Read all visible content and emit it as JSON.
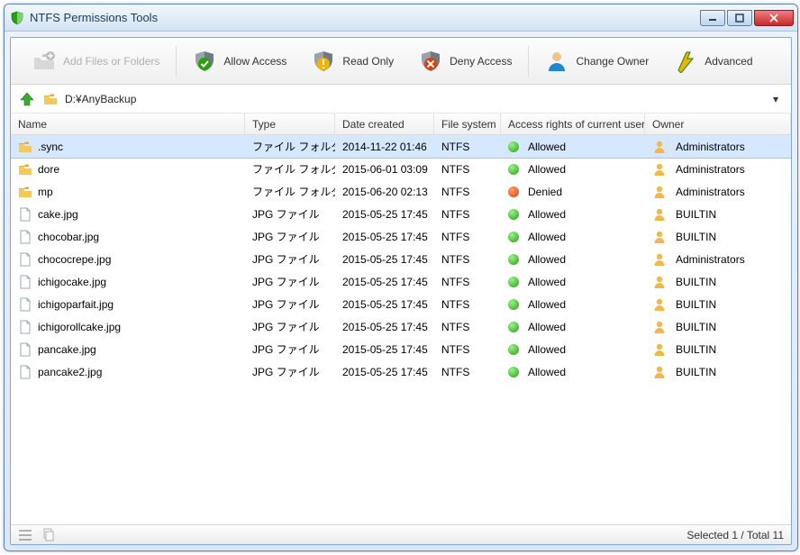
{
  "window": {
    "title": "NTFS Permissions Tools"
  },
  "toolbar": {
    "add": "Add Files or Folders",
    "allow": "Allow Access",
    "readonly": "Read Only",
    "deny": "Deny Access",
    "change_owner": "Change Owner",
    "advanced": "Advanced"
  },
  "nav": {
    "path": "D:¥AnyBackup"
  },
  "columns": {
    "name": "Name",
    "type": "Type",
    "date": "Date created",
    "fs": "File system",
    "access": "Access rights of current user",
    "owner": "Owner"
  },
  "rows": [
    {
      "icon": "folder",
      "name": ".sync",
      "type": "ファイル フォルダー",
      "date": "2014-11-22 01:46",
      "fs": "NTFS",
      "access": "Allowed",
      "access_kind": "a",
      "owner": "Administrators",
      "selected": true
    },
    {
      "icon": "folder",
      "name": "dore",
      "type": "ファイル フォルダー",
      "date": "2015-06-01 03:09",
      "fs": "NTFS",
      "access": "Allowed",
      "access_kind": "a",
      "owner": "Administrators"
    },
    {
      "icon": "folder",
      "name": "mp",
      "type": "ファイル フォルダー",
      "date": "2015-06-20 02:13",
      "fs": "NTFS",
      "access": "Denied",
      "access_kind": "d",
      "owner": "Administrators"
    },
    {
      "icon": "file",
      "name": "cake.jpg",
      "type": "JPG ファイル",
      "date": "2015-05-25 17:45",
      "fs": "NTFS",
      "access": "Allowed",
      "access_kind": "a",
      "owner": "BUILTIN"
    },
    {
      "icon": "file",
      "name": "chocobar.jpg",
      "type": "JPG ファイル",
      "date": "2015-05-25 17:45",
      "fs": "NTFS",
      "access": "Allowed",
      "access_kind": "a",
      "owner": "BUILTIN"
    },
    {
      "icon": "file",
      "name": "chococrepe.jpg",
      "type": "JPG ファイル",
      "date": "2015-05-25 17:45",
      "fs": "NTFS",
      "access": "Allowed",
      "access_kind": "a",
      "owner": "Administrators"
    },
    {
      "icon": "file",
      "name": "ichigocake.jpg",
      "type": "JPG ファイル",
      "date": "2015-05-25 17:45",
      "fs": "NTFS",
      "access": "Allowed",
      "access_kind": "a",
      "owner": "BUILTIN"
    },
    {
      "icon": "file",
      "name": "ichigoparfait.jpg",
      "type": "JPG ファイル",
      "date": "2015-05-25 17:45",
      "fs": "NTFS",
      "access": "Allowed",
      "access_kind": "a",
      "owner": "BUILTIN"
    },
    {
      "icon": "file",
      "name": "ichigorollcake.jpg",
      "type": "JPG ファイル",
      "date": "2015-05-25 17:45",
      "fs": "NTFS",
      "access": "Allowed",
      "access_kind": "a",
      "owner": "BUILTIN"
    },
    {
      "icon": "file",
      "name": "pancake.jpg",
      "type": "JPG ファイル",
      "date": "2015-05-25 17:45",
      "fs": "NTFS",
      "access": "Allowed",
      "access_kind": "a",
      "owner": "BUILTIN"
    },
    {
      "icon": "file",
      "name": "pancake2.jpg",
      "type": "JPG ファイル",
      "date": "2015-05-25 17:45",
      "fs": "NTFS",
      "access": "Allowed",
      "access_kind": "a",
      "owner": "BUILTIN"
    }
  ],
  "status": {
    "text": "Selected 1 / Total 11"
  }
}
